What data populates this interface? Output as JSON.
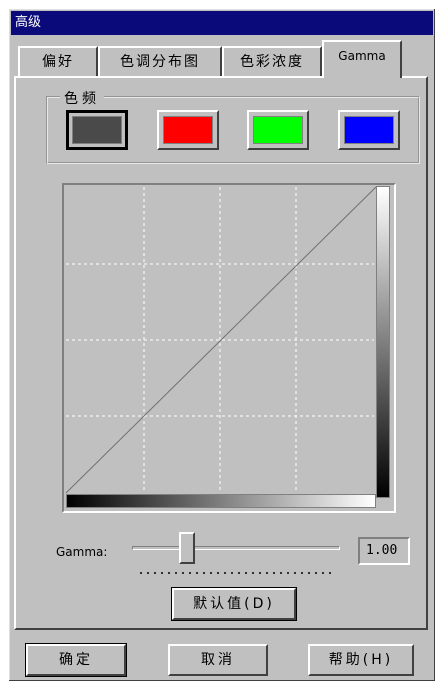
{
  "window": {
    "title": "高级"
  },
  "tabs": [
    {
      "label": "偏好",
      "active": false
    },
    {
      "label": "色调分布图",
      "active": false
    },
    {
      "label": "色彩浓度",
      "active": false
    },
    {
      "label": "Gamma",
      "active": true
    }
  ],
  "color_group": {
    "label": "色频",
    "swatches": [
      {
        "name": "gray",
        "color": "#4a4a4a",
        "selected": true
      },
      {
        "name": "red",
        "color": "#ff0000",
        "selected": false
      },
      {
        "name": "green",
        "color": "#00ff00",
        "selected": false
      },
      {
        "name": "blue",
        "color": "#0000ff",
        "selected": false
      }
    ]
  },
  "gamma": {
    "label": "Gamma:",
    "value": "1.00"
  },
  "buttons": {
    "default": "默认值(D)",
    "ok": "确定",
    "cancel": "取消",
    "help": "帮助(H)"
  }
}
